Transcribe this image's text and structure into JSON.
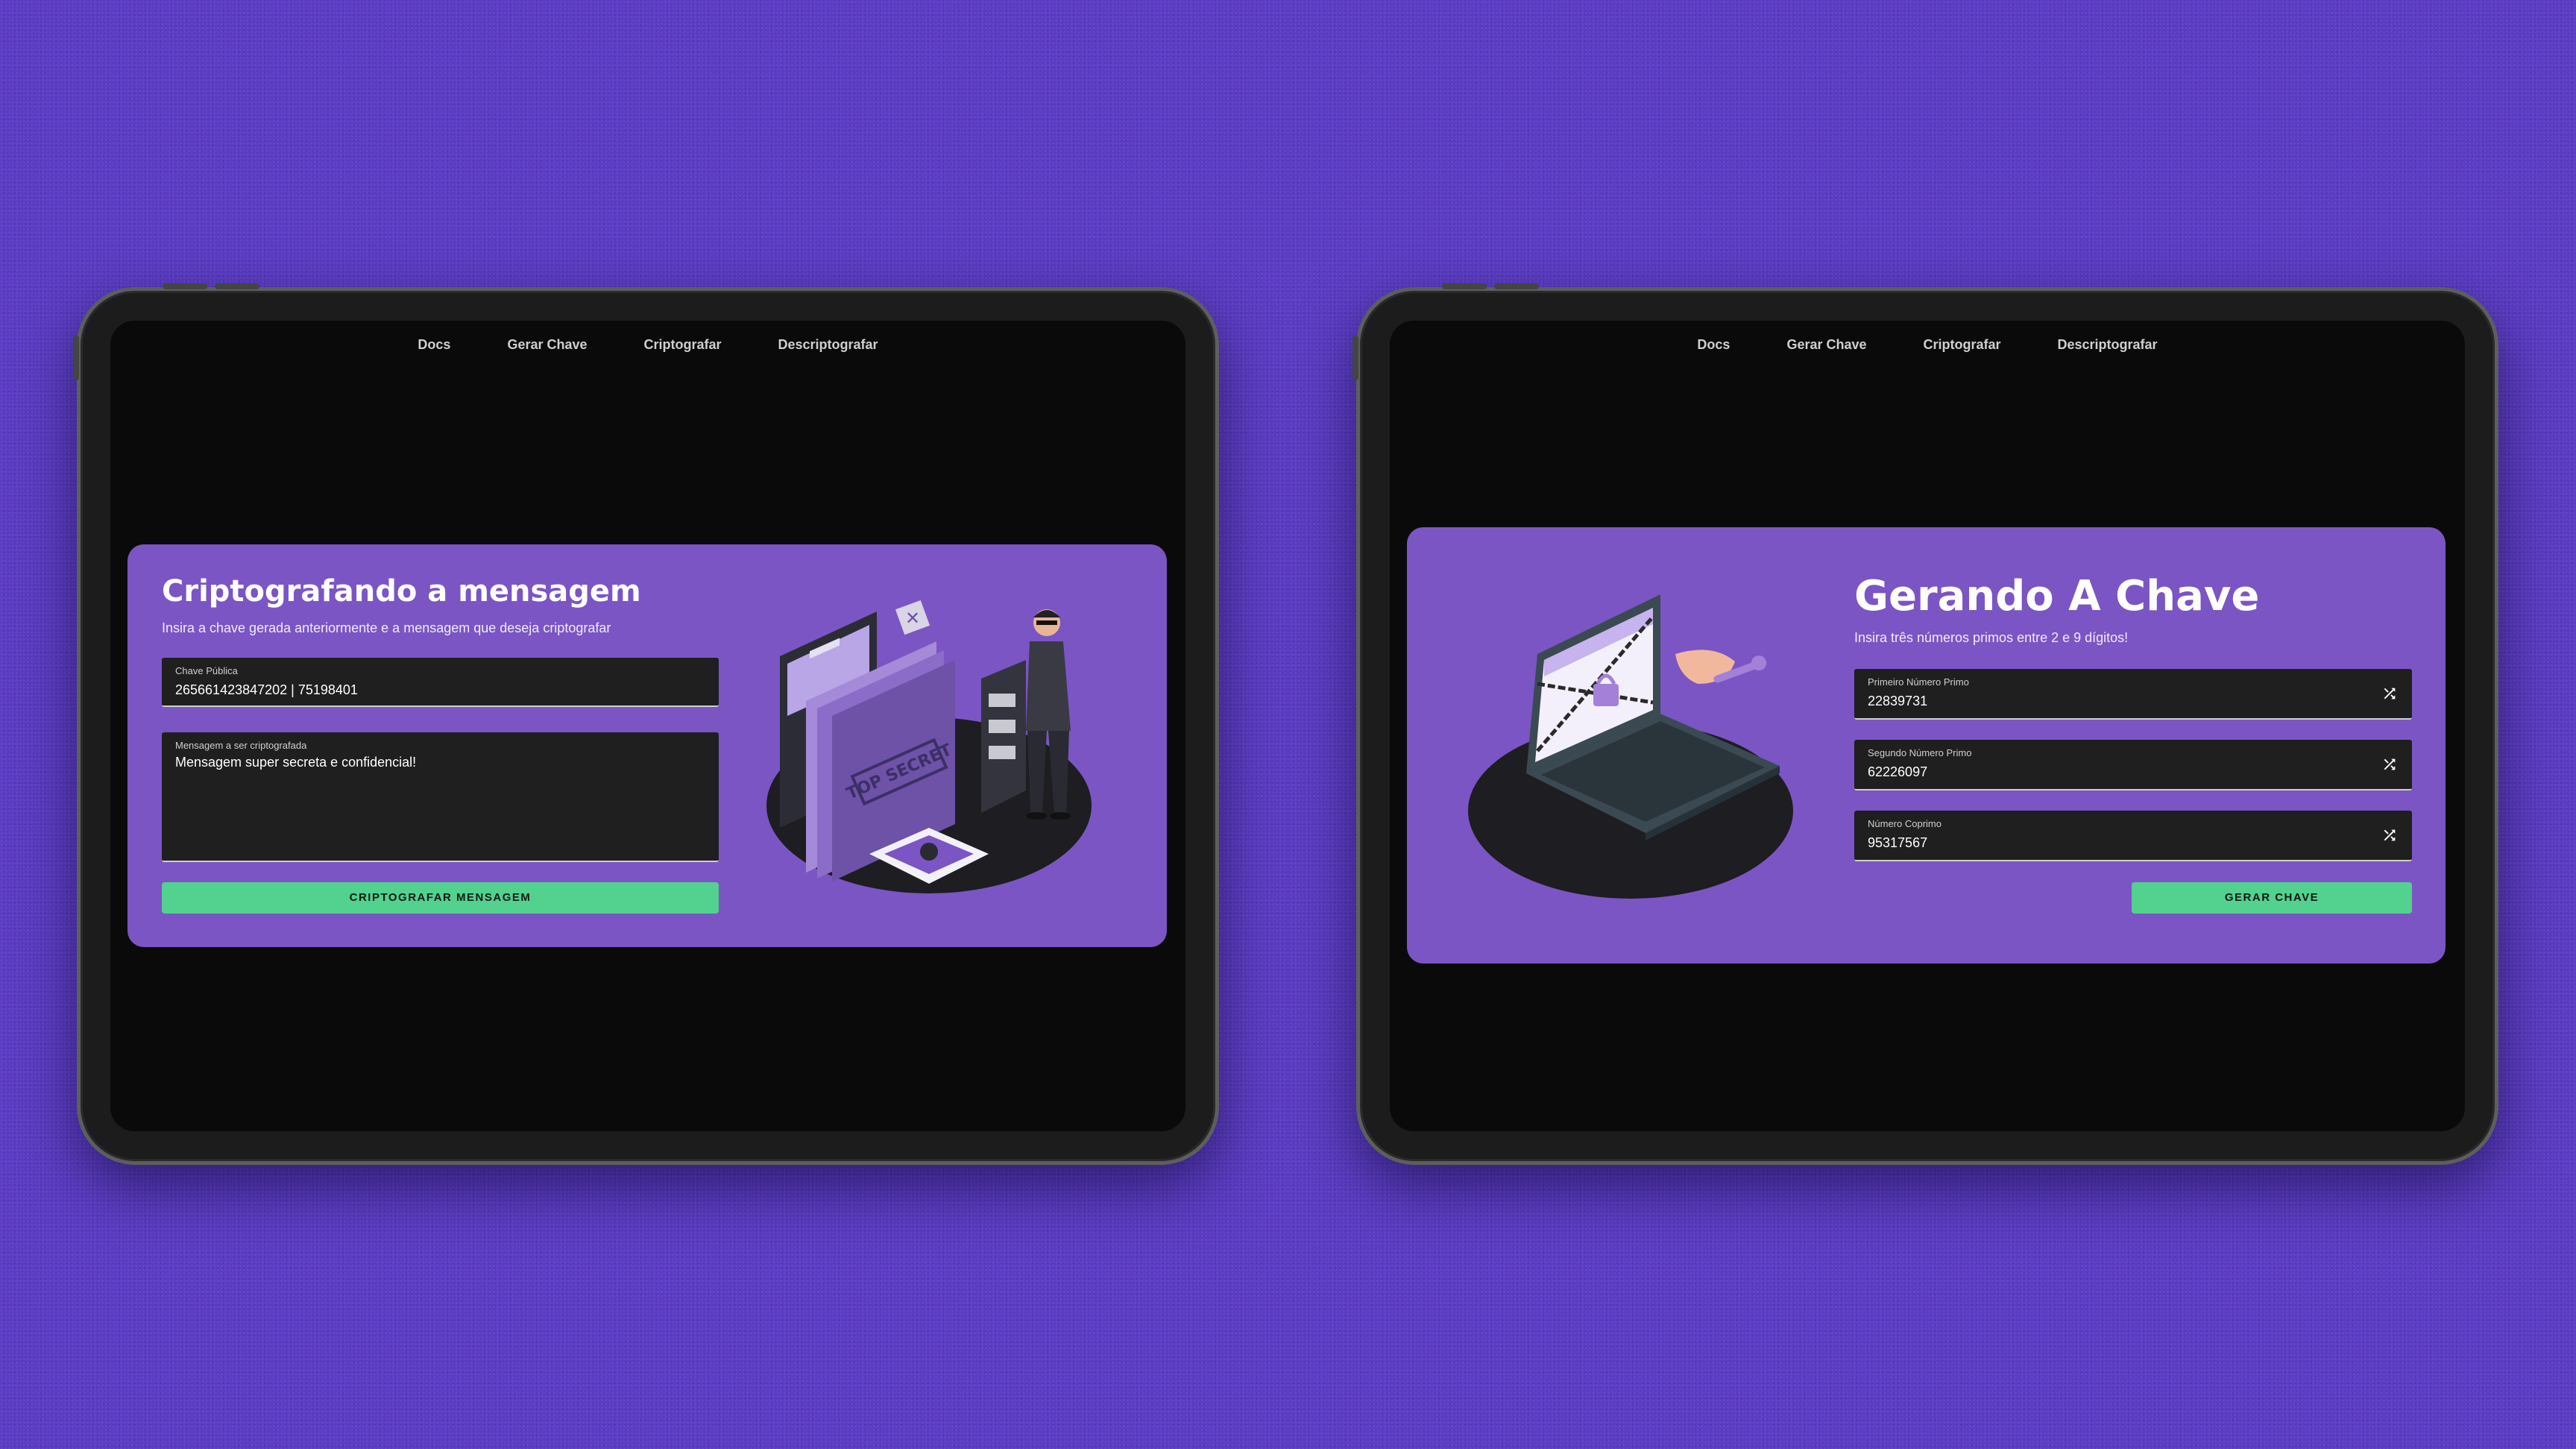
{
  "nav": [
    "Docs",
    "Gerar Chave",
    "Criptografar",
    "Descriptografar"
  ],
  "encrypt": {
    "title": "Criptografando a mensagem",
    "subtitle": "Insira a chave gerada anteriormente e a mensagem que deseja criptografar",
    "key_label": "Chave Pública",
    "key_value": "265661423847202 | 75198401",
    "message_label": "Mensagem a ser criptografada",
    "message_value": "Mensagem super secreta e confidencial!",
    "button": "CRIPTOGRAFAR MENSAGEM",
    "illustration_text": "TOP SECRET"
  },
  "generate": {
    "title": "Gerando A Chave",
    "subtitle": "Insira três números primos entre 2 e 9 dígitos!",
    "fields": [
      {
        "label": "Primeiro Número Primo",
        "value": "22839731"
      },
      {
        "label": "Segundo Número Primo",
        "value": "62226097"
      },
      {
        "label": "Número Coprimo",
        "value": "95317567"
      }
    ],
    "button": "GERAR CHAVE"
  },
  "colors": {
    "background": "#5b3cc4",
    "card": "#7b55c4",
    "button": "#52d18f",
    "screen": "#0a0a0a"
  }
}
